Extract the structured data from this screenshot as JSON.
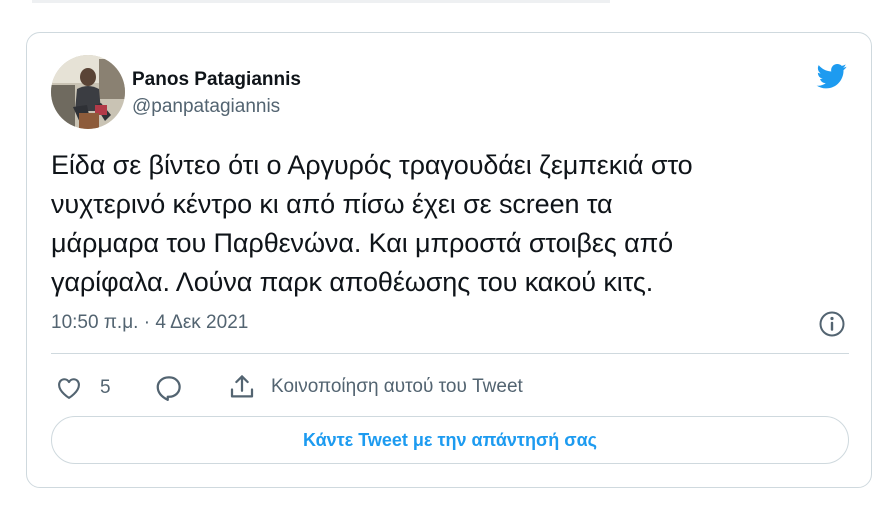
{
  "tweet": {
    "author_name": "Panos Patagiannis",
    "author_handle": "@panpatagiannis",
    "text": "Είδα σε βίντεο ότι ο Αργυρός τραγουδάει ζεμπεκιά στο\nνυχτερινό κέντρο κι από πίσω έχει σε screen τα\nμάρμαρα του Παρθενώνα. Και μπροστά στοιβες από\nγαρίφαλα. Λούνα παρκ αποθέωσης του κακού κιτς.",
    "timestamp": "10:50 π.μ. · 4 Δεκ 2021",
    "like_count": "5",
    "share_label": "Κοινοποίηση αυτού του Tweet",
    "reply_button_label": "Κάντε Tweet με την απάντησή σας"
  },
  "icons": {
    "brand": "twitter-bird-icon",
    "info": "info-icon",
    "like": "heart-icon",
    "reply": "reply-bubble-icon",
    "share": "share-upload-icon"
  },
  "colors": {
    "brand_blue": "#1d9bf0",
    "text_primary": "#0f1419",
    "text_secondary": "#536471",
    "border": "#cfd9de"
  }
}
